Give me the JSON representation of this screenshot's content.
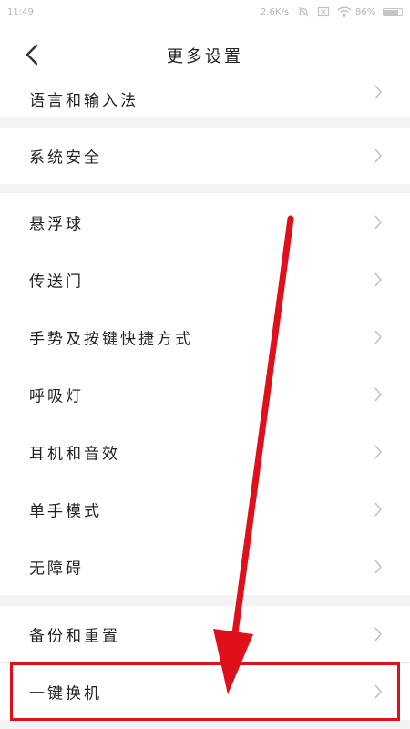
{
  "status_bar": {
    "time": "11:49",
    "net_speed": "2.6K/s",
    "battery": "86%",
    "icons": [
      "alarm-off-icon",
      "sim-x-icon",
      "wifi-icon",
      "battery-icon"
    ]
  },
  "header": {
    "title": "更多设置",
    "back_icon": "chevron-left-icon"
  },
  "settings": {
    "language_input": "语言和输入法",
    "system_security": "系统安全",
    "floating_ball": "悬浮球",
    "portal": "传送门",
    "gestures_shortcuts": "手势及按键快捷方式",
    "breathing_light": "呼吸灯",
    "earphones_audio": "耳机和音效",
    "one_handed_mode": "单手模式",
    "accessibility": "无障碍",
    "backup_reset": "备份和重置",
    "one_click_migration": "一键换机"
  },
  "annotation": {
    "highlight_color": "#e0101a",
    "target": "one_click_migration"
  }
}
